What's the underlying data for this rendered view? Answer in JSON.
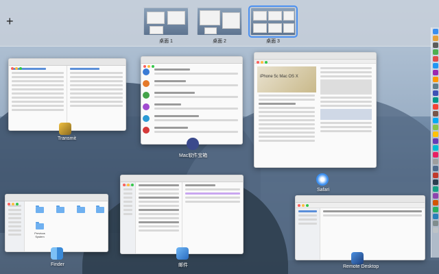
{
  "mission_control": {
    "add_space": "+",
    "spaces": [
      {
        "label": "桌面 1",
        "active": false
      },
      {
        "label": "桌面 2",
        "active": false
      },
      {
        "label": "桌面 3",
        "active": true
      }
    ],
    "windows": [
      {
        "app": "Transmit"
      },
      {
        "app": "Mac软件宝箱"
      },
      {
        "app": "Safari"
      },
      {
        "app": "Finder"
      },
      {
        "app": "邮件"
      },
      {
        "app": "Remote Desktop"
      }
    ],
    "finder_folders": [
      "Previous System"
    ],
    "safari_headline": "iPhone 5c Mac OS X"
  },
  "colors": {
    "accent": "#4a8ff0",
    "bar": "#c8d0da"
  }
}
